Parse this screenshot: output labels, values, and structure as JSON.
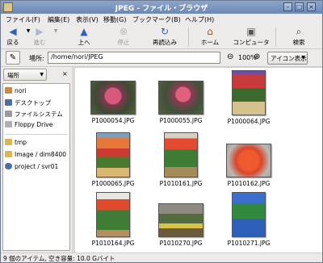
{
  "window": {
    "title": "JPEG - ファイル・ブラウザ"
  },
  "menu": [
    "ファイル(F)",
    "編集(E)",
    "表示(V)",
    "移動(G)",
    "ブックマーク(B)",
    "ヘルプ(H)"
  ],
  "toolbar": {
    "back": "戻る",
    "forward": "進む",
    "up": "上へ",
    "stop": "停止",
    "reload": "再読込み",
    "home": "ホーム",
    "computer": "コンピュータ",
    "search": "検索"
  },
  "location": {
    "label": "場所:",
    "path": "/home/nori/JPEG",
    "zoom": "100%",
    "view": "アイコン表示"
  },
  "sidebar": {
    "header": "場所",
    "items": [
      "nori",
      "デスクトップ",
      "ファイルシステム",
      "Floppy Drive"
    ],
    "bookmarks": [
      "tmp",
      "Image / dim8400",
      "project / svr01"
    ]
  },
  "files": [
    "P1000054.JPG",
    "P1000055.JPG",
    "P1000064.JPG",
    "P1000065.JPG",
    "P1010161.JPG",
    "P1010162.JPG",
    "P1010164.JPG",
    "P1010270.JPG",
    "P1010271.JPG"
  ],
  "status": "9 個のアイテム, 空き容量: 10.0 Gバイト",
  "colors": {
    "titlebar": "#6c88b6",
    "accent": "#4b6fae"
  }
}
